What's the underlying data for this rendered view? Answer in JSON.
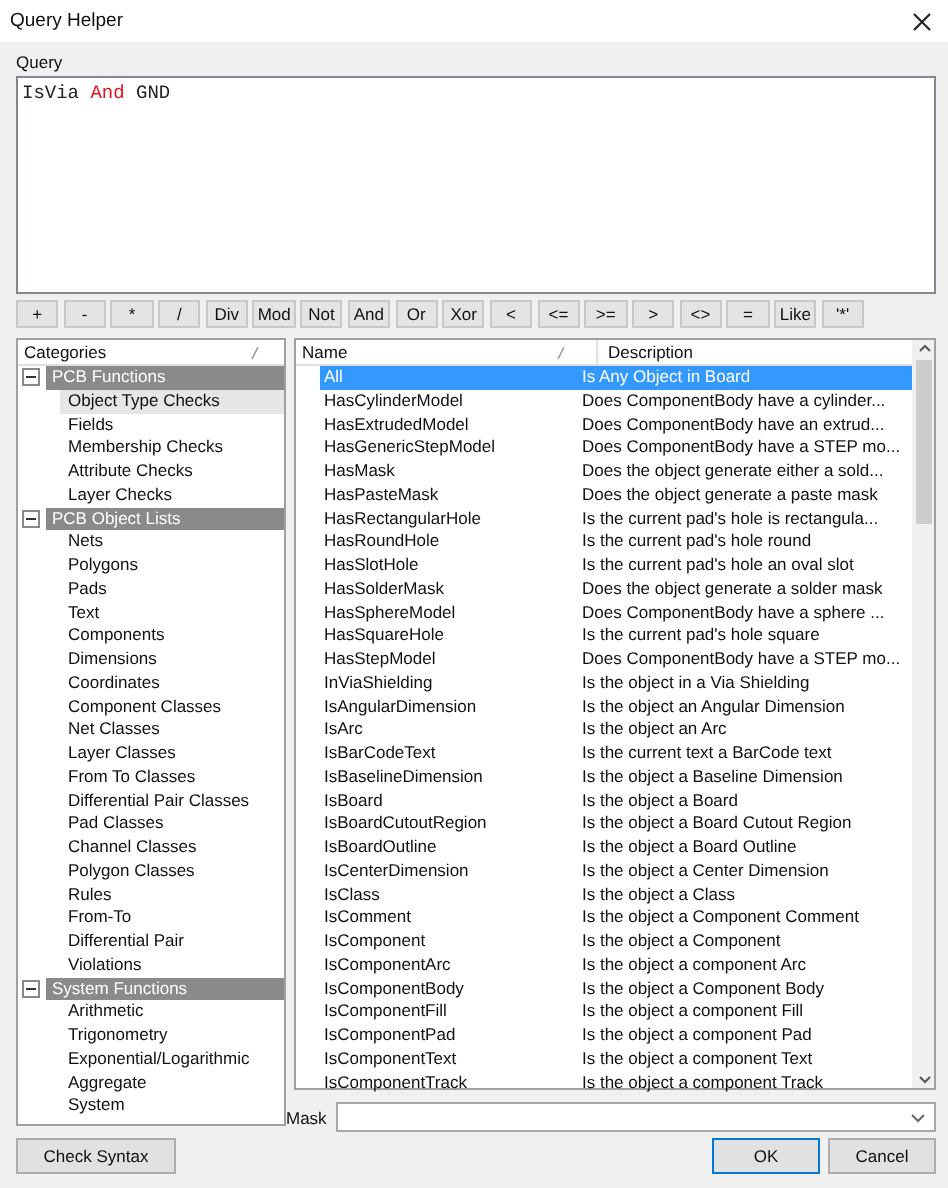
{
  "window": {
    "title": "Query Helper"
  },
  "query": {
    "label": "Query",
    "tokens": [
      {
        "text": "IsVia",
        "kind": "identifier"
      },
      {
        "text": "And",
        "kind": "operator"
      },
      {
        "text": "GND",
        "kind": "identifier"
      }
    ]
  },
  "operators": [
    "+",
    "-",
    "*",
    "/",
    "Div",
    "Mod",
    "Not",
    "And",
    "Or",
    "Xor",
    "<",
    "<=",
    ">=",
    ">",
    "<>",
    "=",
    "Like",
    "'*'"
  ],
  "categories": {
    "header": "Categories",
    "groups": [
      {
        "label": "PCB Functions",
        "expanded": true,
        "children": [
          {
            "label": "Object Type Checks",
            "selected": true
          },
          {
            "label": "Fields",
            "selected": false
          },
          {
            "label": "Membership Checks",
            "selected": false
          },
          {
            "label": "Attribute Checks",
            "selected": false
          },
          {
            "label": "Layer Checks",
            "selected": false
          }
        ]
      },
      {
        "label": "PCB Object Lists",
        "expanded": true,
        "children": [
          {
            "label": "Nets",
            "selected": false
          },
          {
            "label": "Polygons",
            "selected": false
          },
          {
            "label": "Pads",
            "selected": false
          },
          {
            "label": "Text",
            "selected": false
          },
          {
            "label": "Components",
            "selected": false
          },
          {
            "label": "Dimensions",
            "selected": false
          },
          {
            "label": "Coordinates",
            "selected": false
          },
          {
            "label": "Component Classes",
            "selected": false
          },
          {
            "label": "Net Classes",
            "selected": false
          },
          {
            "label": "Layer Classes",
            "selected": false
          },
          {
            "label": "From To Classes",
            "selected": false
          },
          {
            "label": "Differential Pair Classes",
            "selected": false
          },
          {
            "label": "Pad Classes",
            "selected": false
          },
          {
            "label": "Channel Classes",
            "selected": false
          },
          {
            "label": "Polygon Classes",
            "selected": false
          },
          {
            "label": "Rules",
            "selected": false
          },
          {
            "label": "From-To",
            "selected": false
          },
          {
            "label": "Differential Pair",
            "selected": false
          },
          {
            "label": "Violations",
            "selected": false
          }
        ]
      },
      {
        "label": "System Functions",
        "expanded": true,
        "children": [
          {
            "label": "Arithmetic",
            "selected": false
          },
          {
            "label": "Trigonometry",
            "selected": false
          },
          {
            "label": "Exponential/Logarithmic",
            "selected": false
          },
          {
            "label": "Aggregate",
            "selected": false
          },
          {
            "label": "System",
            "selected": false
          }
        ]
      }
    ]
  },
  "functions": {
    "columns": [
      "Name",
      "Description"
    ],
    "rows": [
      {
        "name": "All",
        "description": "Is Any Object in Board",
        "selected": true
      },
      {
        "name": "HasCylinderModel",
        "description": "Does ComponentBody have a cylinder...",
        "selected": false
      },
      {
        "name": "HasExtrudedModel",
        "description": "Does ComponentBody have an extrud...",
        "selected": false
      },
      {
        "name": "HasGenericStepModel",
        "description": "Does ComponentBody have a STEP mo...",
        "selected": false
      },
      {
        "name": "HasMask",
        "description": "Does the object generate either a sold...",
        "selected": false
      },
      {
        "name": "HasPasteMask",
        "description": "Does the object generate a paste mask",
        "selected": false
      },
      {
        "name": "HasRectangularHole",
        "description": "Is the current pad's hole is rectangula...",
        "selected": false
      },
      {
        "name": "HasRoundHole",
        "description": "Is the current pad's hole round",
        "selected": false
      },
      {
        "name": "HasSlotHole",
        "description": "Is the current pad's hole an oval slot",
        "selected": false
      },
      {
        "name": "HasSolderMask",
        "description": "Does the object generate a solder mask",
        "selected": false
      },
      {
        "name": "HasSphereModel",
        "description": "Does ComponentBody have a sphere ...",
        "selected": false
      },
      {
        "name": "HasSquareHole",
        "description": "Is the current pad's hole square",
        "selected": false
      },
      {
        "name": "HasStepModel",
        "description": "Does ComponentBody have a STEP mo...",
        "selected": false
      },
      {
        "name": "InViaShielding",
        "description": "Is the object in a Via Shielding",
        "selected": false
      },
      {
        "name": "IsAngularDimension",
        "description": "Is the object an Angular Dimension",
        "selected": false
      },
      {
        "name": "IsArc",
        "description": "Is the object an Arc",
        "selected": false
      },
      {
        "name": "IsBarCodeText",
        "description": "Is the current text a BarCode text",
        "selected": false
      },
      {
        "name": "IsBaselineDimension",
        "description": "Is the object a Baseline Dimension",
        "selected": false
      },
      {
        "name": "IsBoard",
        "description": "Is the object a Board",
        "selected": false
      },
      {
        "name": "IsBoardCutoutRegion",
        "description": "Is the object a Board Cutout Region",
        "selected": false
      },
      {
        "name": "IsBoardOutline",
        "description": "Is the object a Board Outline",
        "selected": false
      },
      {
        "name": "IsCenterDimension",
        "description": "Is the object a Center Dimension",
        "selected": false
      },
      {
        "name": "IsClass",
        "description": "Is the object a Class",
        "selected": false
      },
      {
        "name": "IsComment",
        "description": "Is the object a Component Comment",
        "selected": false
      },
      {
        "name": "IsComponent",
        "description": "Is the object a Component",
        "selected": false
      },
      {
        "name": "IsComponentArc",
        "description": "Is the object a component Arc",
        "selected": false
      },
      {
        "name": "IsComponentBody",
        "description": "Is the object a Component Body",
        "selected": false
      },
      {
        "name": "IsComponentFill",
        "description": "Is the object a component Fill",
        "selected": false
      },
      {
        "name": "IsComponentPad",
        "description": "Is the object a component Pad",
        "selected": false
      },
      {
        "name": "IsComponentText",
        "description": "Is the object a component Text",
        "selected": false
      },
      {
        "name": "IsComponentTrack",
        "description": "Is the object a component Track",
        "selected": false
      }
    ]
  },
  "mask": {
    "label": "Mask"
  },
  "check_syntax_button": {
    "label": "Check Syntax"
  },
  "dialog_buttons": [
    {
      "label": "OK",
      "default": true
    },
    {
      "label": "Cancel",
      "default": false
    }
  ]
}
